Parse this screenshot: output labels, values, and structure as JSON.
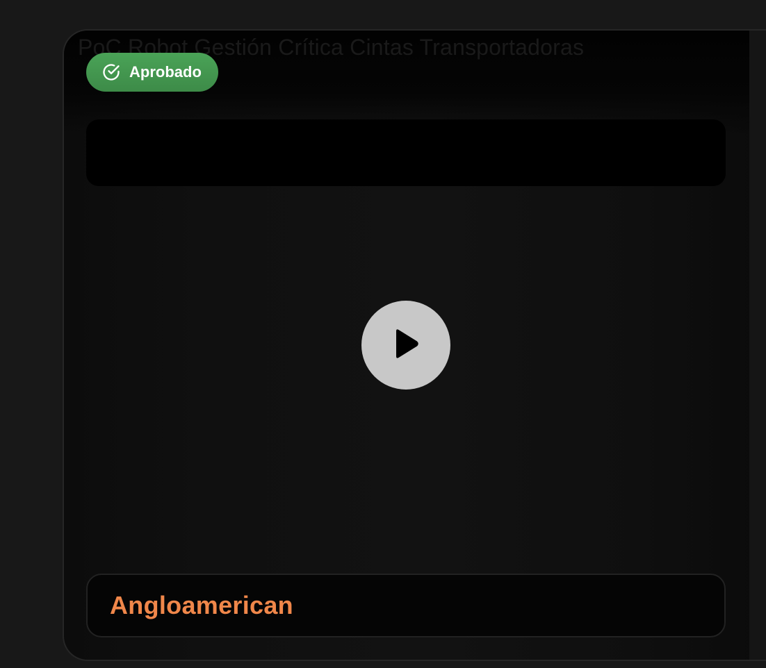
{
  "project": {
    "title": "PoC Robot Gestión Crítica Cintas Transportadoras",
    "status_label": "Aprobado",
    "status_icon": "check-circle-icon",
    "status_color": "#45994f",
    "description": "",
    "media_icon": "play-icon",
    "client_name": "Angloamerican",
    "client_color": "#f0874a"
  }
}
